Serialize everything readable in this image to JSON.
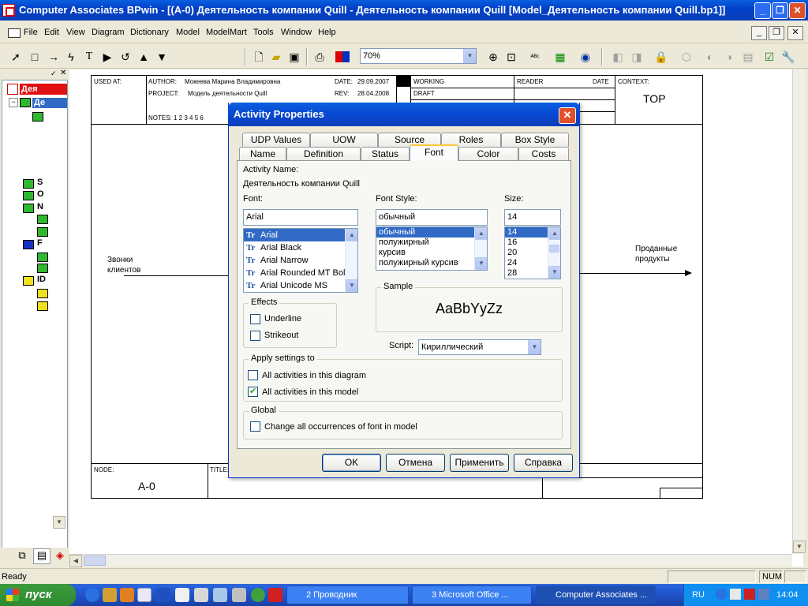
{
  "window": {
    "title": "Computer Associates BPwin - [(A-0) Деятельность компании Quill - Деятельность компании Quill  [Model_Деятельность компании Quill.bp1]]"
  },
  "menu": [
    "File",
    "Edit",
    "View",
    "Diagram",
    "Dictionary",
    "Model",
    "ModelMart",
    "Tools",
    "Window",
    "Help"
  ],
  "toolbar": {
    "zoom": "70%"
  },
  "tree": {
    "root_label": "Дея",
    "items": [
      "Де",
      "S",
      "O",
      "N",
      "F",
      "ID"
    ]
  },
  "diagram": {
    "used_at": "USED AT:",
    "author_label": "AUTHOR:",
    "author": "Мокеева Марина Владимировна",
    "project_label": "PROJECT:",
    "project": "Модель деятельности Quill",
    "date_label": "DATE:",
    "date": "29.09.2007",
    "rev_label": "REV:",
    "rev": "28.04.2008",
    "notes": "NOTES:  1  2  3  4  5  6",
    "working": "WORKING",
    "draft": "DRAFT",
    "reader": "READER",
    "reader_date": "DATE",
    "context": "CONTEXT:",
    "top": "TOP",
    "input_arrow": "Звонки клиентов",
    "output_arrow": "Проданные продукты",
    "node_label": "NODE:",
    "node": "A-0",
    "title_label": "TITLE:"
  },
  "dialog": {
    "title": "Activity Properties",
    "tabs_back": [
      "UDP Values",
      "UOW",
      "Source",
      "Roles",
      "Box Style"
    ],
    "tabs_front": [
      "Name",
      "Definition",
      "Status",
      "Font",
      "Color",
      "Costs"
    ],
    "selected_tab": "Font",
    "activity_name_label": "Activity Name:",
    "activity_name": "Деятельность компании Quill",
    "font_label": "Font:",
    "font_value": "Arial",
    "fonts": [
      "Arial",
      "Arial Black",
      "Arial Narrow",
      "Arial Rounded MT Bol",
      "Arial Unicode MS"
    ],
    "style_label": "Font Style:",
    "style_value": "обычный",
    "styles": [
      "обычный",
      "полужирный",
      "курсив",
      "полужирный курсив"
    ],
    "size_label": "Size:",
    "size_value": "14",
    "sizes": [
      "14",
      "16",
      "20",
      "24",
      "28"
    ],
    "effects_label": "Effects",
    "underline": "Underline",
    "strikeout": "Strikeout",
    "sample_label": "Sample",
    "sample_text": "AaBbYyZz",
    "script_label": "Script:",
    "script_value": "Кириллический",
    "apply_label": "Apply settings to",
    "apply_diagram": "All activities in this diagram",
    "apply_model": "All activities in this model",
    "apply_diagram_checked": false,
    "apply_model_checked": true,
    "global_label": "Global",
    "global_change": "Change all occurrences of font in model",
    "ok": "OK",
    "cancel": "Отмена",
    "apply": "Применить",
    "help": "Справка"
  },
  "status": {
    "text": "Ready",
    "num": "NUM"
  },
  "taskbar": {
    "start": "пуск",
    "tasks": [
      "2 Проводник",
      "3 Microsoft Office ...",
      "Computer Associates ..."
    ],
    "lang": "RU",
    "clock": "14:04"
  },
  "colors": {
    "xp_blue": "#0a5fe0",
    "start_green": "#3c9a3c",
    "tree_highlight": "#e01010"
  }
}
